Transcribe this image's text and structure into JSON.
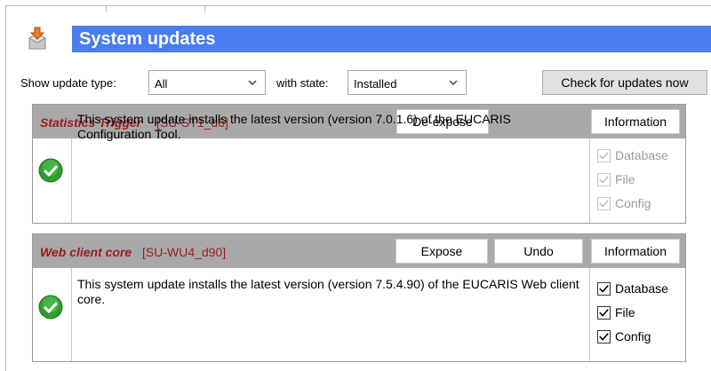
{
  "title": "System updates",
  "filters": {
    "type_label": "Show update type:",
    "type_value": "All",
    "state_label": "with state:",
    "state_value": "Installed",
    "check_button": "Check for updates now"
  },
  "updates": [
    {
      "name": "Statistics Trigger",
      "code": "[SU-ST1_d6]",
      "description": "This system update installs the latest version (version 7.0.1.6) of the EUCARIS Configuration Tool.",
      "buttons": [
        "De-expose",
        "Information"
      ],
      "checks": [
        {
          "label": "Database",
          "checked": true,
          "enabled": false
        },
        {
          "label": "File",
          "checked": true,
          "enabled": false
        },
        {
          "label": "Config",
          "checked": true,
          "enabled": false
        }
      ]
    },
    {
      "name": "Web client core",
      "code": "[SU-WU4_d90]",
      "description": "This system update installs the latest version (version 7.5.4.90) of the EUCARIS Web client core.",
      "buttons": [
        "Expose",
        "Undo",
        "Information"
      ],
      "checks": [
        {
          "label": "Database",
          "checked": true,
          "enabled": true
        },
        {
          "label": "File",
          "checked": true,
          "enabled": true
        },
        {
          "label": "Config",
          "checked": true,
          "enabled": true
        }
      ]
    }
  ],
  "colors": {
    "title_bar": "#4a7df0",
    "update_header": "#a9a9a9",
    "update_name": "#9b1c1c",
    "ok_green": "#2f9e2f"
  },
  "icons": {
    "header": "install-package-icon",
    "status": "check-ok-icon"
  }
}
